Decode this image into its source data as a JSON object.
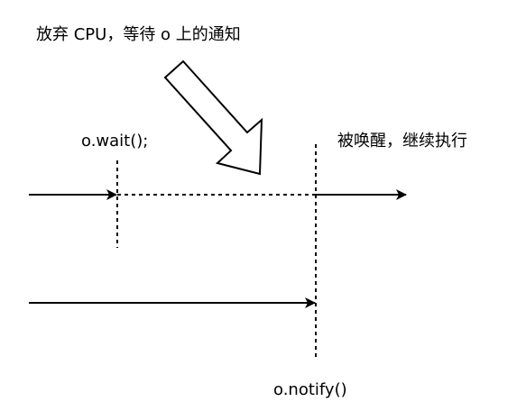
{
  "labels": {
    "release_note": "放弃 CPU，等待 o 上的通知",
    "wait_call": "o.wait();",
    "woken_note": "被唤醒，继续执行",
    "notify_call": "o.notify()"
  },
  "colors": {
    "stroke": "#000000",
    "background": "#ffffff"
  }
}
